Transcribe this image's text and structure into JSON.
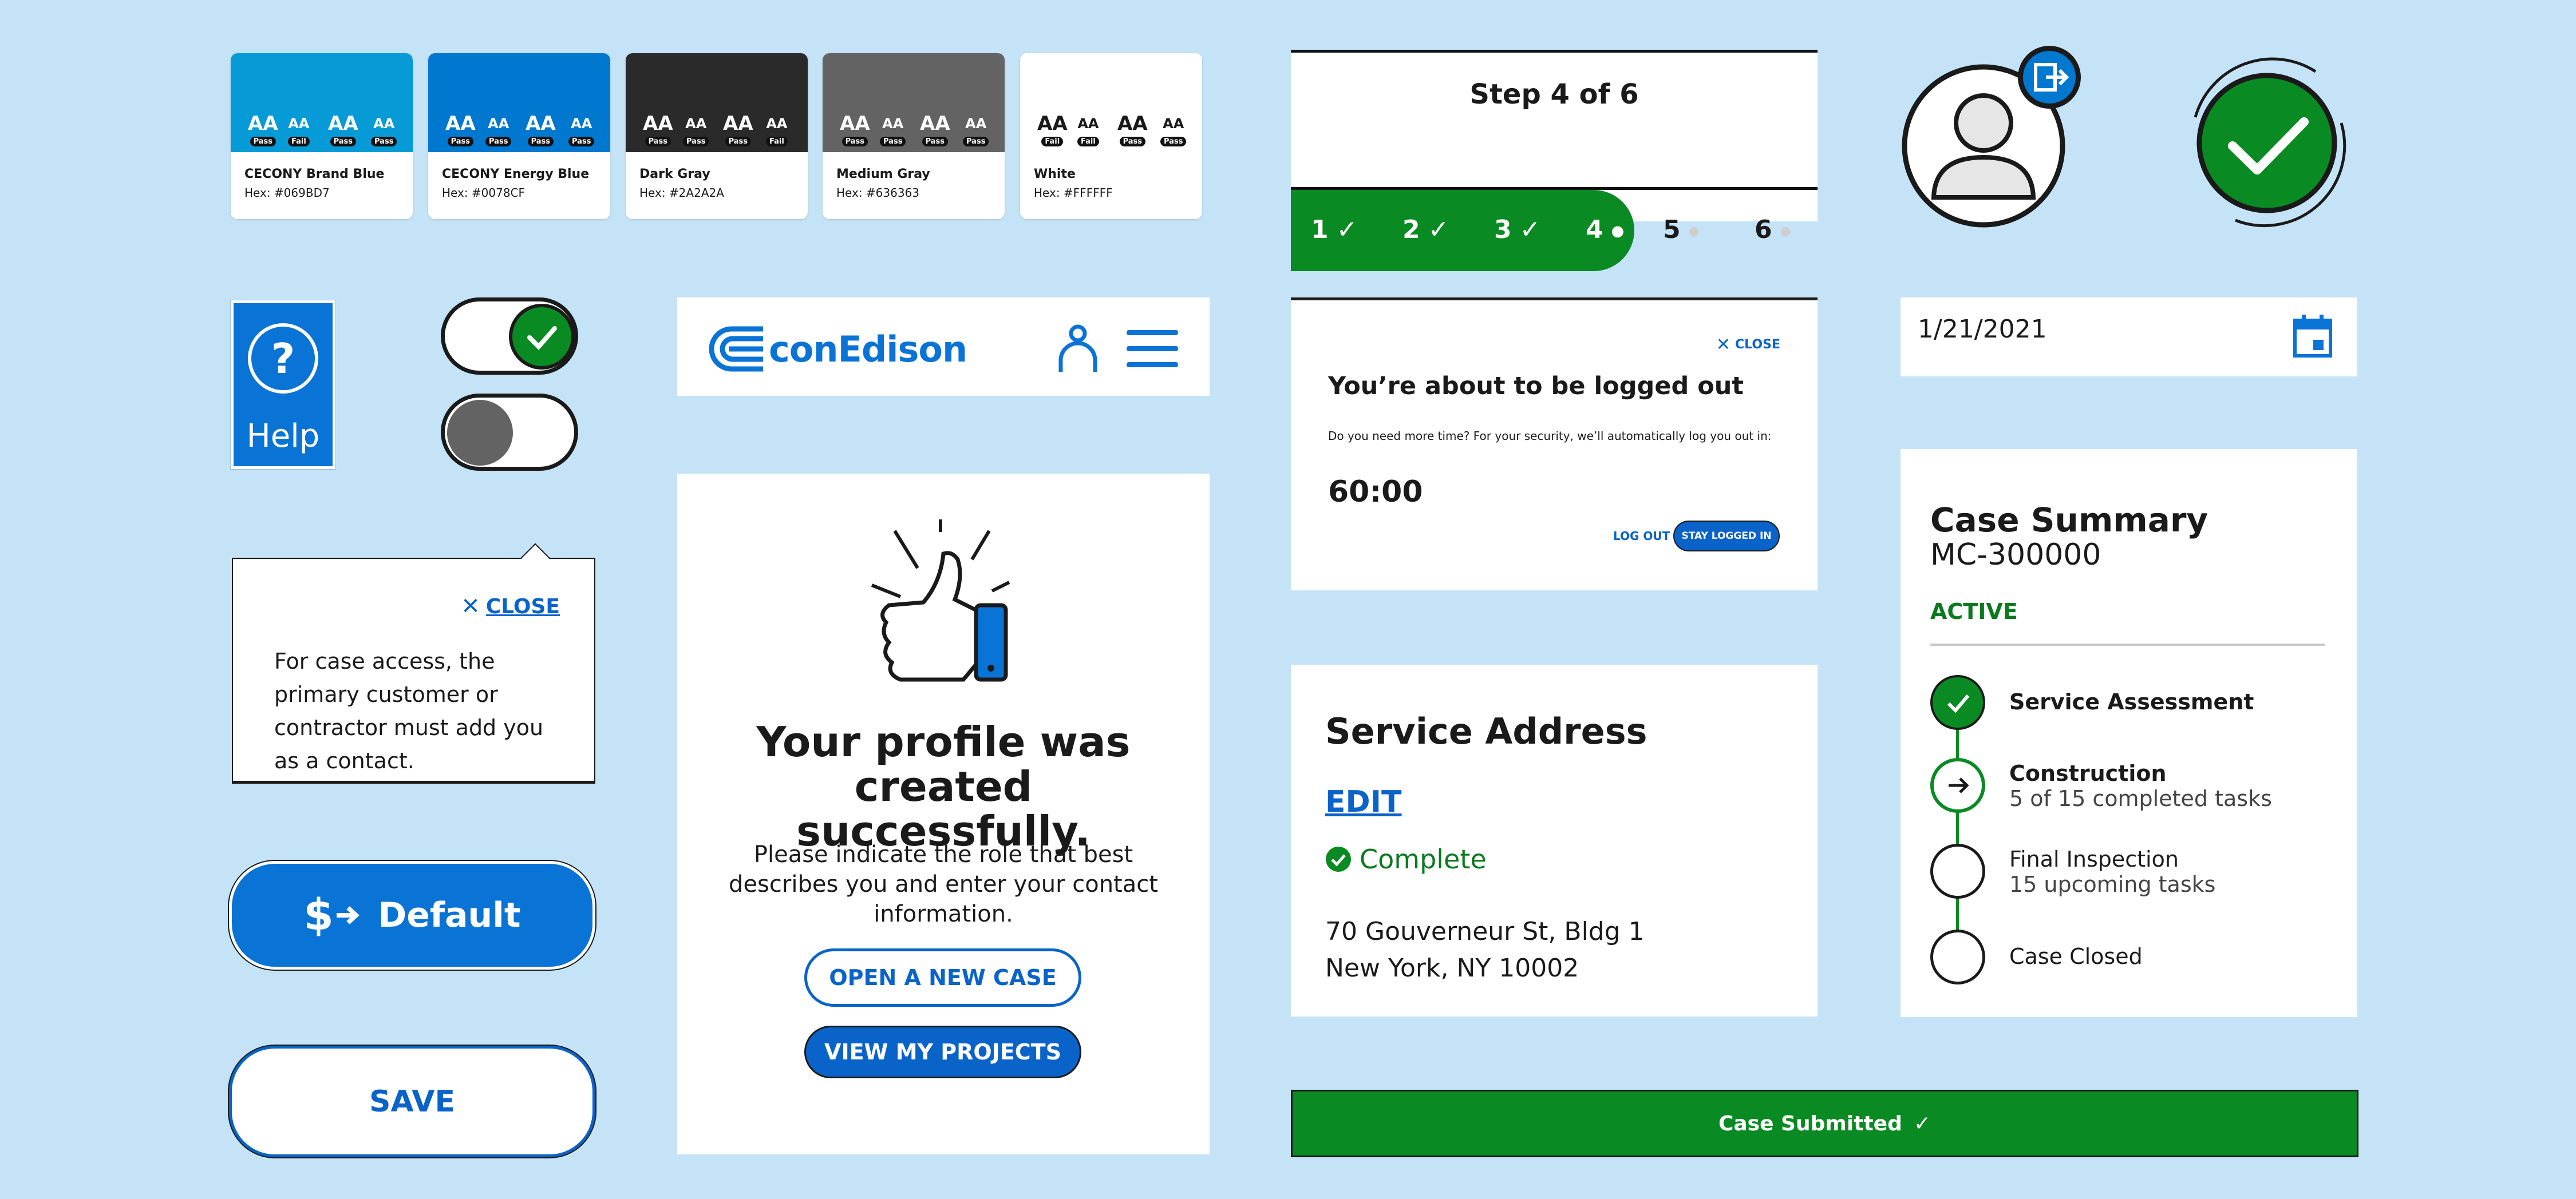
{
  "swatches": [
    {
      "name": "CECONY Brand Blue",
      "hex": "Hex: #069BD7",
      "color": "#069bd7",
      "text": "#ffffff",
      "pills": [
        "Pass",
        "Fail",
        "Pass",
        "Pass"
      ]
    },
    {
      "name": "CECONY Energy Blue",
      "hex": "Hex: #0078CF",
      "color": "#0078cf",
      "text": "#ffffff",
      "pills": [
        "Pass",
        "Pass",
        "Pass",
        "Pass"
      ]
    },
    {
      "name": "Dark Gray",
      "hex": "Hex: #2A2A2A",
      "color": "#2a2a2a",
      "text": "#ffffff",
      "pills": [
        "Pass",
        "Pass",
        "Pass",
        "Fail"
      ]
    },
    {
      "name": "Medium Gray",
      "hex": "Hex: #636363",
      "color": "#636363",
      "text": "#ffffff",
      "pills": [
        "Pass",
        "Pass",
        "Pass",
        "Pass"
      ]
    },
    {
      "name": "White",
      "hex": "Hex: #FFFFFF",
      "color": "#ffffff",
      "text": "#1a1a1a",
      "pills": [
        "Fail",
        "Fail",
        "Pass",
        "Pass"
      ]
    }
  ],
  "swatch_aa": "AA",
  "stepper": {
    "title": "Step 4 of 6",
    "steps": [
      "1",
      "2",
      "3",
      "4",
      "5",
      "6"
    ],
    "current": 4,
    "done_mark": "✓",
    "pending_mark": "●"
  },
  "help": {
    "label": "Help",
    "icon": "?"
  },
  "logo": {
    "text": "conEdison"
  },
  "tooltip": {
    "close": "CLOSE",
    "text": "For case access, the primary customer or contractor must add you as a contact."
  },
  "profile_card": {
    "title": "Your profile was created successfully.",
    "body": "Please indicate the role that best describes you and enter your contact information.",
    "btn_new_case": "OPEN A NEW CASE",
    "btn_projects": "VIEW MY PROJECTS"
  },
  "buttons": {
    "default": "Default",
    "save": "SAVE"
  },
  "logout_modal": {
    "close": "CLOSE",
    "title": "You’re about to be logged out",
    "body": "Do you need more time? For your security, we’ll automatically log you out in:",
    "timer": "60:00",
    "logout": "LOG OUT",
    "stay": "STAY LOGGED IN"
  },
  "service_address": {
    "title": "Service Address",
    "edit": "EDIT",
    "status": "Complete",
    "line1": "70 Gouverneur St, Bldg 1",
    "line2": "New York, NY 10002"
  },
  "case_submitted": {
    "label": "Case Submitted",
    "mark": "✓"
  },
  "date_field": {
    "value": "1/21/2021"
  },
  "case_summary": {
    "title": "Case Summary",
    "case_id": "MC-300000",
    "status": "ACTIVE",
    "steps": [
      {
        "label": "Service Assessment",
        "sub": "",
        "state": "done"
      },
      {
        "label": "Construction",
        "sub": "5 of 15 completed tasks",
        "state": "current"
      },
      {
        "label": "Final Inspection",
        "sub": "15 upcoming tasks",
        "state": "pending"
      },
      {
        "label": "Case Closed",
        "sub": "",
        "state": "pending"
      }
    ]
  },
  "colors": {
    "background": "#c5e3f7",
    "green": "#0a8a22",
    "energy_blue": "#0078cf",
    "link_blue": "#0a63c9"
  }
}
